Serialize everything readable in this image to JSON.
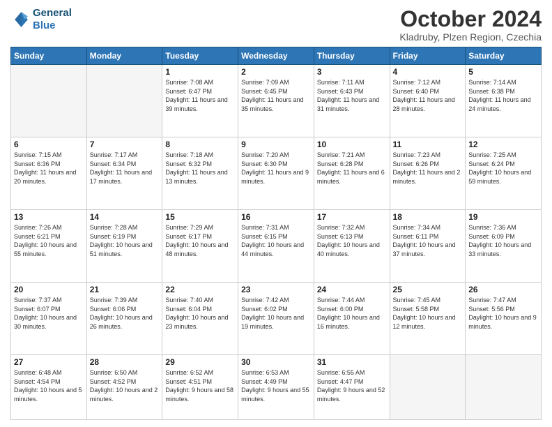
{
  "logo": {
    "line1": "General",
    "line2": "Blue"
  },
  "title": "October 2024",
  "subtitle": "Kladruby, Plzen Region, Czechia",
  "days_of_week": [
    "Sunday",
    "Monday",
    "Tuesday",
    "Wednesday",
    "Thursday",
    "Friday",
    "Saturday"
  ],
  "weeks": [
    [
      {
        "day": "",
        "sunrise": "",
        "sunset": "",
        "daylight": ""
      },
      {
        "day": "",
        "sunrise": "",
        "sunset": "",
        "daylight": ""
      },
      {
        "day": "1",
        "sunrise": "Sunrise: 7:08 AM",
        "sunset": "Sunset: 6:47 PM",
        "daylight": "Daylight: 11 hours and 39 minutes."
      },
      {
        "day": "2",
        "sunrise": "Sunrise: 7:09 AM",
        "sunset": "Sunset: 6:45 PM",
        "daylight": "Daylight: 11 hours and 35 minutes."
      },
      {
        "day": "3",
        "sunrise": "Sunrise: 7:11 AM",
        "sunset": "Sunset: 6:43 PM",
        "daylight": "Daylight: 11 hours and 31 minutes."
      },
      {
        "day": "4",
        "sunrise": "Sunrise: 7:12 AM",
        "sunset": "Sunset: 6:40 PM",
        "daylight": "Daylight: 11 hours and 28 minutes."
      },
      {
        "day": "5",
        "sunrise": "Sunrise: 7:14 AM",
        "sunset": "Sunset: 6:38 PM",
        "daylight": "Daylight: 11 hours and 24 minutes."
      }
    ],
    [
      {
        "day": "6",
        "sunrise": "Sunrise: 7:15 AM",
        "sunset": "Sunset: 6:36 PM",
        "daylight": "Daylight: 11 hours and 20 minutes."
      },
      {
        "day": "7",
        "sunrise": "Sunrise: 7:17 AM",
        "sunset": "Sunset: 6:34 PM",
        "daylight": "Daylight: 11 hours and 17 minutes."
      },
      {
        "day": "8",
        "sunrise": "Sunrise: 7:18 AM",
        "sunset": "Sunset: 6:32 PM",
        "daylight": "Daylight: 11 hours and 13 minutes."
      },
      {
        "day": "9",
        "sunrise": "Sunrise: 7:20 AM",
        "sunset": "Sunset: 6:30 PM",
        "daylight": "Daylight: 11 hours and 9 minutes."
      },
      {
        "day": "10",
        "sunrise": "Sunrise: 7:21 AM",
        "sunset": "Sunset: 6:28 PM",
        "daylight": "Daylight: 11 hours and 6 minutes."
      },
      {
        "day": "11",
        "sunrise": "Sunrise: 7:23 AM",
        "sunset": "Sunset: 6:26 PM",
        "daylight": "Daylight: 11 hours and 2 minutes."
      },
      {
        "day": "12",
        "sunrise": "Sunrise: 7:25 AM",
        "sunset": "Sunset: 6:24 PM",
        "daylight": "Daylight: 10 hours and 59 minutes."
      }
    ],
    [
      {
        "day": "13",
        "sunrise": "Sunrise: 7:26 AM",
        "sunset": "Sunset: 6:21 PM",
        "daylight": "Daylight: 10 hours and 55 minutes."
      },
      {
        "day": "14",
        "sunrise": "Sunrise: 7:28 AM",
        "sunset": "Sunset: 6:19 PM",
        "daylight": "Daylight: 10 hours and 51 minutes."
      },
      {
        "day": "15",
        "sunrise": "Sunrise: 7:29 AM",
        "sunset": "Sunset: 6:17 PM",
        "daylight": "Daylight: 10 hours and 48 minutes."
      },
      {
        "day": "16",
        "sunrise": "Sunrise: 7:31 AM",
        "sunset": "Sunset: 6:15 PM",
        "daylight": "Daylight: 10 hours and 44 minutes."
      },
      {
        "day": "17",
        "sunrise": "Sunrise: 7:32 AM",
        "sunset": "Sunset: 6:13 PM",
        "daylight": "Daylight: 10 hours and 40 minutes."
      },
      {
        "day": "18",
        "sunrise": "Sunrise: 7:34 AM",
        "sunset": "Sunset: 6:11 PM",
        "daylight": "Daylight: 10 hours and 37 minutes."
      },
      {
        "day": "19",
        "sunrise": "Sunrise: 7:36 AM",
        "sunset": "Sunset: 6:09 PM",
        "daylight": "Daylight: 10 hours and 33 minutes."
      }
    ],
    [
      {
        "day": "20",
        "sunrise": "Sunrise: 7:37 AM",
        "sunset": "Sunset: 6:07 PM",
        "daylight": "Daylight: 10 hours and 30 minutes."
      },
      {
        "day": "21",
        "sunrise": "Sunrise: 7:39 AM",
        "sunset": "Sunset: 6:06 PM",
        "daylight": "Daylight: 10 hours and 26 minutes."
      },
      {
        "day": "22",
        "sunrise": "Sunrise: 7:40 AM",
        "sunset": "Sunset: 6:04 PM",
        "daylight": "Daylight: 10 hours and 23 minutes."
      },
      {
        "day": "23",
        "sunrise": "Sunrise: 7:42 AM",
        "sunset": "Sunset: 6:02 PM",
        "daylight": "Daylight: 10 hours and 19 minutes."
      },
      {
        "day": "24",
        "sunrise": "Sunrise: 7:44 AM",
        "sunset": "Sunset: 6:00 PM",
        "daylight": "Daylight: 10 hours and 16 minutes."
      },
      {
        "day": "25",
        "sunrise": "Sunrise: 7:45 AM",
        "sunset": "Sunset: 5:58 PM",
        "daylight": "Daylight: 10 hours and 12 minutes."
      },
      {
        "day": "26",
        "sunrise": "Sunrise: 7:47 AM",
        "sunset": "Sunset: 5:56 PM",
        "daylight": "Daylight: 10 hours and 9 minutes."
      }
    ],
    [
      {
        "day": "27",
        "sunrise": "Sunrise: 6:48 AM",
        "sunset": "Sunset: 4:54 PM",
        "daylight": "Daylight: 10 hours and 5 minutes."
      },
      {
        "day": "28",
        "sunrise": "Sunrise: 6:50 AM",
        "sunset": "Sunset: 4:52 PM",
        "daylight": "Daylight: 10 hours and 2 minutes."
      },
      {
        "day": "29",
        "sunrise": "Sunrise: 6:52 AM",
        "sunset": "Sunset: 4:51 PM",
        "daylight": "Daylight: 9 hours and 58 minutes."
      },
      {
        "day": "30",
        "sunrise": "Sunrise: 6:53 AM",
        "sunset": "Sunset: 4:49 PM",
        "daylight": "Daylight: 9 hours and 55 minutes."
      },
      {
        "day": "31",
        "sunrise": "Sunrise: 6:55 AM",
        "sunset": "Sunset: 4:47 PM",
        "daylight": "Daylight: 9 hours and 52 minutes."
      },
      {
        "day": "",
        "sunrise": "",
        "sunset": "",
        "daylight": ""
      },
      {
        "day": "",
        "sunrise": "",
        "sunset": "",
        "daylight": ""
      }
    ]
  ]
}
